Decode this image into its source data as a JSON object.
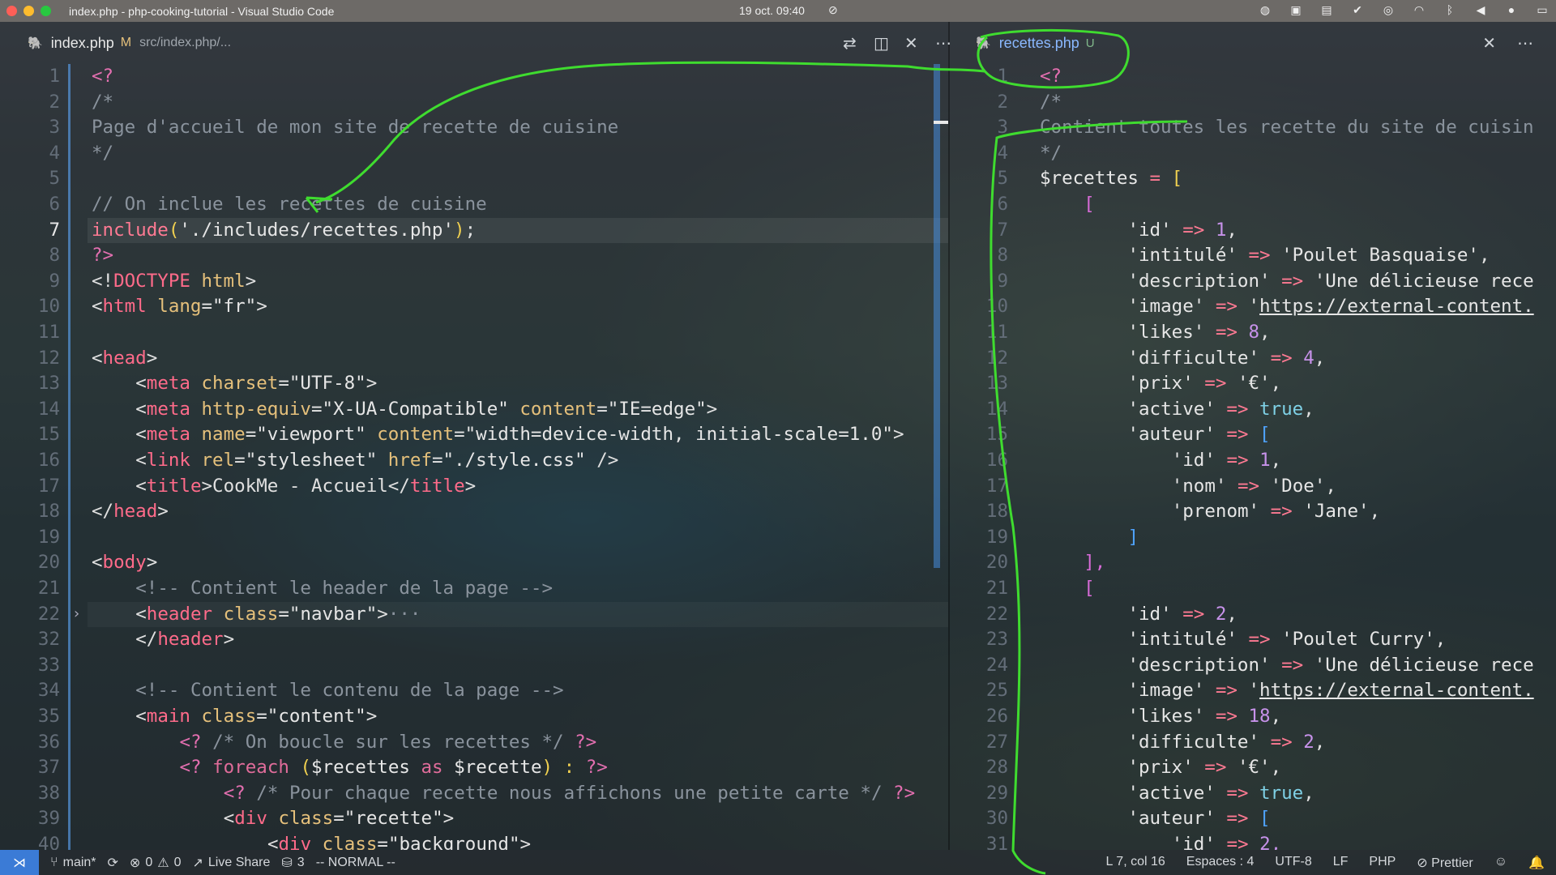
{
  "titlebar": {
    "window_title": "index.php - php-cooking-tutorial - Visual Studio Code",
    "clock": "19 oct.  09:40",
    "tray_icons": [
      "screen-icon",
      "zoom-icon",
      "app-icon",
      "check-icon",
      "circle-icon",
      "wifi-icon",
      "bluetooth-icon",
      "volume-icon",
      "mic-icon",
      "battery-icon"
    ]
  },
  "left_tab": {
    "filename": "index.php",
    "modified": "M",
    "path": "src/index.php/...",
    "actions": [
      "compare-changes-icon",
      "split-editor-icon",
      "close-icon",
      "more-icon"
    ]
  },
  "right_tab": {
    "filename": "recettes.php",
    "status": "U",
    "actions": [
      "close-icon",
      "more-icon"
    ]
  },
  "left_lines": {
    "n": [
      "1",
      "2",
      "3",
      "4",
      "5",
      "6",
      "7",
      "8",
      "9",
      "10",
      "11",
      "12",
      "13",
      "14",
      "15",
      "16",
      "17",
      "18",
      "19",
      "20",
      "21",
      "22",
      "32",
      "33",
      "34",
      "35",
      "36",
      "37",
      "38",
      "39",
      "40"
    ],
    "l1": "<?",
    "l2": "/*",
    "l3": "Page d'accueil de mon site de recette de cuisine",
    "l4": "*/",
    "l6": "// On inclue les recettes de cuisine",
    "l7a": "include",
    "l7b": "(",
    "l7c": "'./includes/recettes.php'",
    "l7d": ")",
    "l7e": ";",
    "l8": "?>",
    "l9a": "<!",
    "l9b": "DOCTYPE",
    "l9c": " html",
    "l9d": ">",
    "l10a": "<",
    "l10b": "html",
    "l10c": " lang",
    "l10d": "=\"fr\"",
    "l10e": ">",
    "l12a": "<",
    "l12b": "head",
    "l12c": ">",
    "l13a": "<",
    "l13b": "meta",
    "l13c": " charset",
    "l13d": "=\"UTF-8\"",
    "l13e": ">",
    "l14a": "<",
    "l14b": "meta",
    "l14c": " http-equiv",
    "l14d": "=\"X-UA-Compatible\"",
    "l14e": " content",
    "l14f": "=\"IE=edge\"",
    "l14g": ">",
    "l15a": "<",
    "l15b": "meta",
    "l15c": " name",
    "l15d": "=\"viewport\"",
    "l15e": " content",
    "l15f": "=\"width=device-width, initial-scale=1.0\"",
    "l15g": ">",
    "l16a": "<",
    "l16b": "link",
    "l16c": " rel",
    "l16d": "=\"stylesheet\"",
    "l16e": " href",
    "l16f": "=\"./style.css\"",
    "l16g": " />",
    "l17a": "<",
    "l17b": "title",
    "l17c": ">CookMe - Accueil</",
    "l17d": "title",
    "l17e": ">",
    "l18a": "</",
    "l18b": "head",
    "l18c": ">",
    "l20a": "<",
    "l20b": "body",
    "l20c": ">",
    "l21": "<!-- Contient le header de la page -->",
    "l22a": "<",
    "l22b": "header",
    "l22c": " class",
    "l22d": "=\"navbar\"",
    "l22e": ">",
    "l22f": "···",
    "l32a": "</",
    "l32b": "header",
    "l32c": ">",
    "l34": "<!-- Contient le contenu de la page -->",
    "l35a": "<",
    "l35b": "main",
    "l35c": " class",
    "l35d": "=\"content\"",
    "l35e": ">",
    "l36a": "<?",
    "l36b": " /* On boucle sur les recettes */ ",
    "l36c": "?>",
    "l37a": "<?",
    "l37b": " foreach",
    "l37c": " (",
    "l37d": "$recettes",
    "l37e": " as ",
    "l37f": "$recette",
    "l37g": ") : ",
    "l37h": "?>",
    "l38a": "<?",
    "l38b": " /* Pour chaque recette nous affichons une petite carte */ ",
    "l38c": "?>",
    "l39a": "<",
    "l39b": "div",
    "l39c": " class",
    "l39d": "=\"recette\"",
    "l39e": ">",
    "l40a": "<",
    "l40b": "div",
    "l40c": " class",
    "l40d": "=\"background\"",
    "l40e": ">"
  },
  "right_lines": {
    "n": [
      "1",
      "2",
      "3",
      "4",
      "5",
      "6",
      "7",
      "8",
      "9",
      "10",
      "11",
      "12",
      "13",
      "14",
      "15",
      "16",
      "17",
      "18",
      "19",
      "20",
      "21",
      "22",
      "23",
      "24",
      "25",
      "26",
      "27",
      "28",
      "29",
      "30",
      "31"
    ],
    "l1": "<?",
    "l2": "/*",
    "l3": "Contient toutes les recette du site de cuisin",
    "l4": "*/",
    "l5a": "$recettes",
    "l5b": " = ",
    "l5c": "[",
    "l6": "[",
    "k_id": "'id'",
    "arrow": " => ",
    "v1": "1",
    "comma": ",",
    "k_intitule": "'intitulé'",
    "v_intitule1": "'Poulet Basquaise'",
    "k_description": "'description'",
    "v_description": "'Une délicieuse rece",
    "k_image": "'image'",
    "v_image_q": "'",
    "v_image": "https://external-content.",
    "k_likes": "'likes'",
    "v_likes1": "8",
    "k_difficulte": "'difficulte'",
    "v_difficulte1": "4",
    "k_prix": "'prix'",
    "v_prix": "'€'",
    "k_active": "'active'",
    "v_active": "true",
    "k_auteur": "'auteur'",
    "open": "[",
    "k_nom": "'nom'",
    "v_nom": "'Doe'",
    "k_prenom": "'prenom'",
    "v_prenom": "'Jane'",
    "close": "]",
    "close_comma": "],",
    "v2": "2",
    "v_intitule2": "'Poulet Curry'",
    "v_likes2": "18",
    "v_difficulte2": "2",
    "v2_partial": "2,"
  },
  "statusbar": {
    "branch": "main*",
    "errors": "0",
    "warnings": "0",
    "live_share": "Live Share",
    "db": "3",
    "mode": "-- NORMAL --",
    "position": "L 7, col 16",
    "spaces": "Espaces : 4",
    "encoding": "UTF-8",
    "eol": "LF",
    "language": "PHP",
    "formatter": "Prettier"
  },
  "colors": {
    "annotation": "#3fdc2f",
    "remote": "#3b7bd6",
    "scrollbar": "#468cdc"
  }
}
